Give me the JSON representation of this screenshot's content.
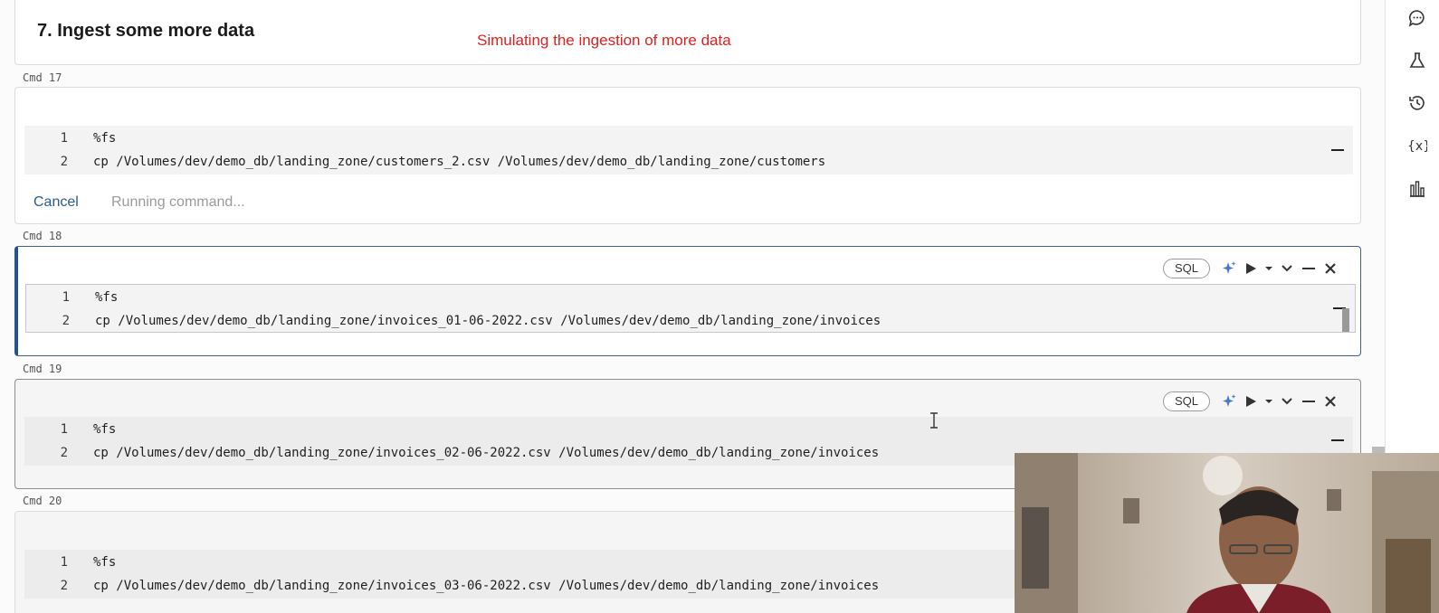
{
  "notebook": {
    "markdown_cell": {
      "title": "7. Ingest some more data",
      "annotation": "Simulating the ingestion of more data",
      "annotation_color": "#e02020"
    },
    "cells": [
      {
        "cmd_label": "Cmd 17",
        "language_badge": "",
        "lines": [
          {
            "num": "1",
            "code": "%fs"
          },
          {
            "num": "2",
            "code": "cp /Volumes/dev/demo_db/landing_zone/customers_2.csv /Volumes/dev/demo_db/landing_zone/customers"
          }
        ],
        "cancel_label": "Cancel",
        "status_text": "Running command..."
      },
      {
        "cmd_label": "Cmd 18",
        "language_badge": "SQL",
        "lines": [
          {
            "num": "1",
            "code": "%fs"
          },
          {
            "num": "2",
            "code": "cp /Volumes/dev/demo_db/landing_zone/invoices_01-06-2022.csv /Volumes/dev/demo_db/landing_zone/invoices"
          }
        ]
      },
      {
        "cmd_label": "Cmd 19",
        "language_badge": "SQL",
        "lines": [
          {
            "num": "1",
            "code": "%fs"
          },
          {
            "num": "2",
            "code": "cp /Volumes/dev/demo_db/landing_zone/invoices_02-06-2022.csv /Volumes/dev/demo_db/landing_zone/invoices"
          }
        ]
      },
      {
        "cmd_label": "Cmd 20",
        "language_badge": "",
        "lines": [
          {
            "num": "1",
            "code": "%fs"
          },
          {
            "num": "2",
            "code": "cp /Volumes/dev/demo_db/landing_zone/invoices_03-06-2022.csv /Volumes/dev/demo_db/landing_zone/invoices"
          }
        ]
      }
    ],
    "toolbar_icons": [
      "assistant-sparkle-icon",
      "run-icon",
      "run-menu-chevron-icon",
      "collapse-chevron-icon",
      "minimize-icon",
      "close-icon"
    ]
  },
  "right_sidebar": {
    "icons": [
      "comments-icon",
      "experiments-icon",
      "revision-history-icon",
      "variables-icon",
      "data-profile-icon"
    ]
  },
  "colors": {
    "selected_cell_border": "#22548b",
    "link_blue": "#2c5a8a",
    "accent_sparkle": "#4a78c8"
  }
}
